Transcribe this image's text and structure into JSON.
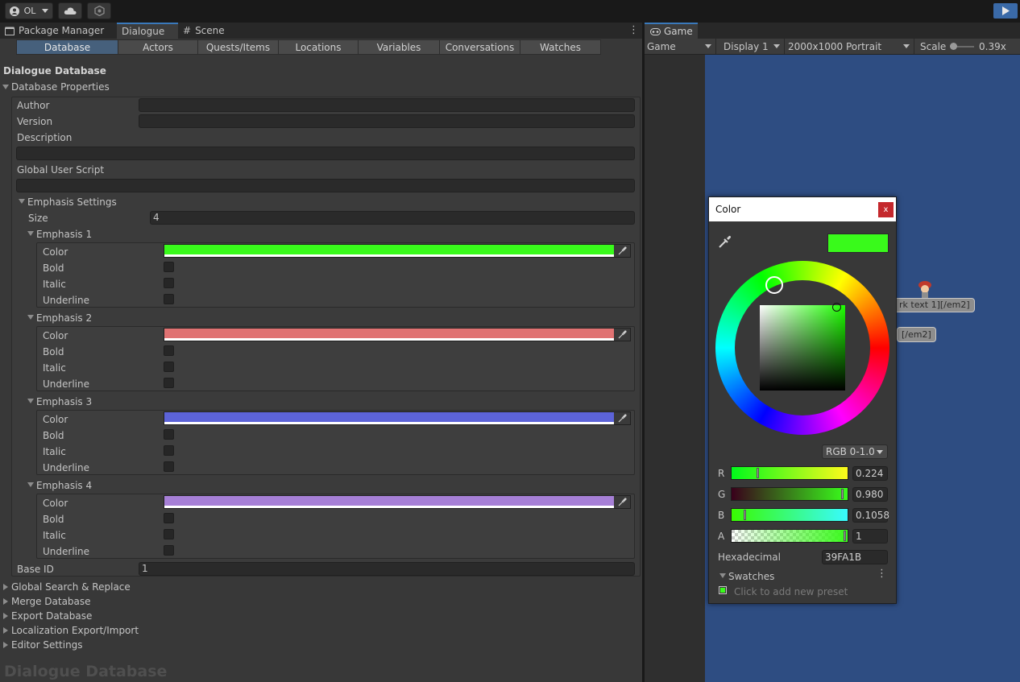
{
  "toolbar": {
    "account_label": "OL",
    "cloud_icon": "cloud-icon",
    "collab_icon": "collab-icon",
    "play_icon": "play-icon"
  },
  "dock_tabs": [
    {
      "label": "Package Manager",
      "icon": "package-icon"
    },
    {
      "label": "Dialogue",
      "icon": ""
    },
    {
      "label": "Scene",
      "icon": "grid-icon"
    }
  ],
  "editor_tabs": [
    "Database",
    "Actors",
    "Quests/Items",
    "Locations",
    "Variables",
    "Conversations",
    "Watches"
  ],
  "database": {
    "header": "Dialogue Database",
    "properties_title": "Database Properties",
    "author_label": "Author",
    "author_value": "",
    "version_label": "Version",
    "version_value": "",
    "description_label": "Description",
    "description_value": "",
    "global_script_label": "Global User Script",
    "global_script_value": "",
    "emphasis_title": "Emphasis Settings",
    "size_label": "Size",
    "size_value": "4",
    "emphases": [
      {
        "title": "Emphasis 1",
        "color": "#39fa1b"
      },
      {
        "title": "Emphasis 2",
        "color": "#e07272"
      },
      {
        "title": "Emphasis 3",
        "color": "#5c63d8"
      },
      {
        "title": "Emphasis 4",
        "color": "#a67fd6"
      }
    ],
    "field_color": "Color",
    "field_bold": "Bold",
    "field_italic": "Italic",
    "field_underline": "Underline",
    "base_id_label": "Base ID",
    "base_id_value": "1",
    "sections": [
      "Global Search & Replace",
      "Merge Database",
      "Export Database",
      "Localization Export/Import",
      "Editor Settings"
    ],
    "watermark": "Dialogue Database"
  },
  "game": {
    "tab_label": "Game",
    "mode": "Game",
    "display": "Display 1",
    "resolution": "2000x1000 Portrait",
    "scale_label": "Scale",
    "scale_value": "0.39x",
    "bubble1": "rk  text  1][/em2]",
    "bubble2": "[/em2]"
  },
  "color_picker": {
    "title": "Color",
    "close_label": "x",
    "current_color": "#39fa1b",
    "mode": "RGB 0-1.0",
    "channels": [
      {
        "label": "R",
        "value": "0.224",
        "fraction": 0.224
      },
      {
        "label": "G",
        "value": "0.980",
        "fraction": 0.98
      },
      {
        "label": "B",
        "value": "0.1058",
        "fraction": 0.1058
      },
      {
        "label": "A",
        "value": "1",
        "fraction": 1
      }
    ],
    "hex_label": "Hexadecimal",
    "hex_value": "39FA1B",
    "swatches_label": "Swatches",
    "add_preset": "Click to add new preset"
  }
}
